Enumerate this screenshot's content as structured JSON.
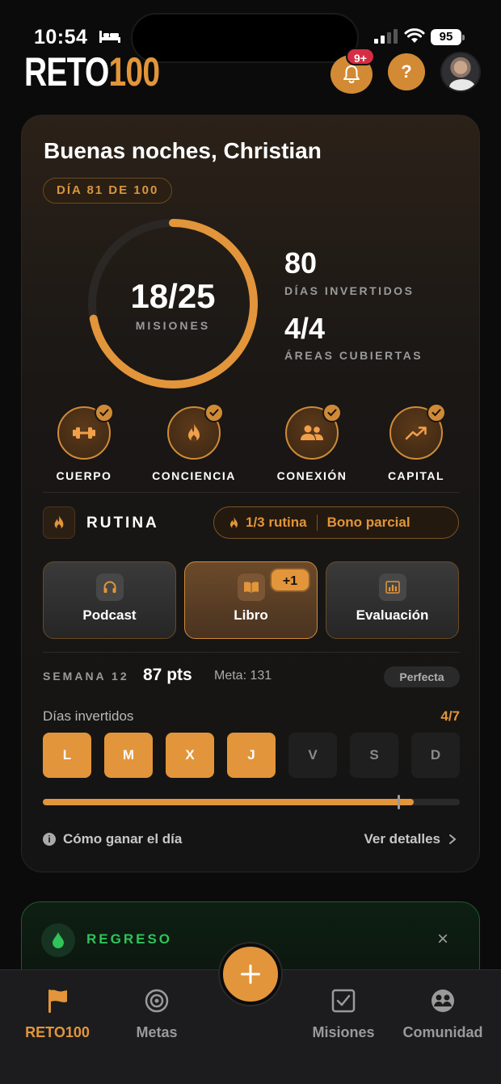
{
  "status_bar": {
    "time": "10:54",
    "battery": "95"
  },
  "header": {
    "logo_part1": "RETO",
    "logo_part2": "100",
    "notification_badge": "9+",
    "help_label": "?"
  },
  "main_card": {
    "greeting": "Buenas noches, Christian",
    "day_pill": "DÍA 81 DE 100",
    "ring": {
      "value": "18/25",
      "label": "MISIONES",
      "progress": 0.72
    },
    "stats": [
      {
        "value": "80",
        "label": "DÍAS INVERTIDOS"
      },
      {
        "value": "4/4",
        "label": "ÁREAS CUBIERTAS"
      }
    ],
    "areas": [
      {
        "label": "CUERPO",
        "icon": "dumbbell-icon",
        "checked": true
      },
      {
        "label": "CONCIENCIA",
        "icon": "flame-icon",
        "checked": true
      },
      {
        "label": "CONEXIÓN",
        "icon": "people-icon",
        "checked": true
      },
      {
        "label": "CAPITAL",
        "icon": "trending-up-icon",
        "checked": true
      }
    ],
    "rutina": {
      "title": "RUTINA",
      "progress_text": "1/3 rutina",
      "bonus_text": "Bono parcial",
      "buttons": [
        {
          "label": "Podcast",
          "icon": "headphones-icon",
          "active": false
        },
        {
          "label": "Libro",
          "icon": "book-icon",
          "active": true,
          "badge": "+1"
        },
        {
          "label": "Evaluación",
          "icon": "bar-chart-icon",
          "active": false
        }
      ]
    },
    "week": {
      "label": "SEMANA 12",
      "points": "87 pts",
      "goal": "Meta: 131",
      "status": "Perfecta",
      "days_label": "Días invertidos",
      "days_count": "4/7",
      "days": [
        {
          "letter": "L",
          "done": true
        },
        {
          "letter": "M",
          "done": true
        },
        {
          "letter": "X",
          "done": true
        },
        {
          "letter": "J",
          "done": true
        },
        {
          "letter": "V",
          "done": false
        },
        {
          "letter": "S",
          "done": false
        },
        {
          "letter": "D",
          "done": false
        }
      ],
      "points_progress": 0.89
    },
    "footer": {
      "how_to": "Cómo ganar el día",
      "details": "Ver detalles",
      "info_glyph": "i"
    }
  },
  "regreso_card": {
    "title": "REGRESO",
    "close": "×"
  },
  "tabbar": {
    "tabs": [
      {
        "label": "RETO100",
        "icon": "flag-icon",
        "active": true
      },
      {
        "label": "Metas",
        "icon": "target-icon",
        "active": false
      },
      {
        "label": "Misiones",
        "icon": "checkbox-icon",
        "active": false
      },
      {
        "label": "Comunidad",
        "icon": "community-icon",
        "active": false
      }
    ],
    "fab_icon": "plus-icon"
  },
  "colors": {
    "accent": "#e2953a",
    "background": "#0b0b0c",
    "card": "#1a1715",
    "success": "#2fc35a",
    "badge": "#d62d44"
  }
}
